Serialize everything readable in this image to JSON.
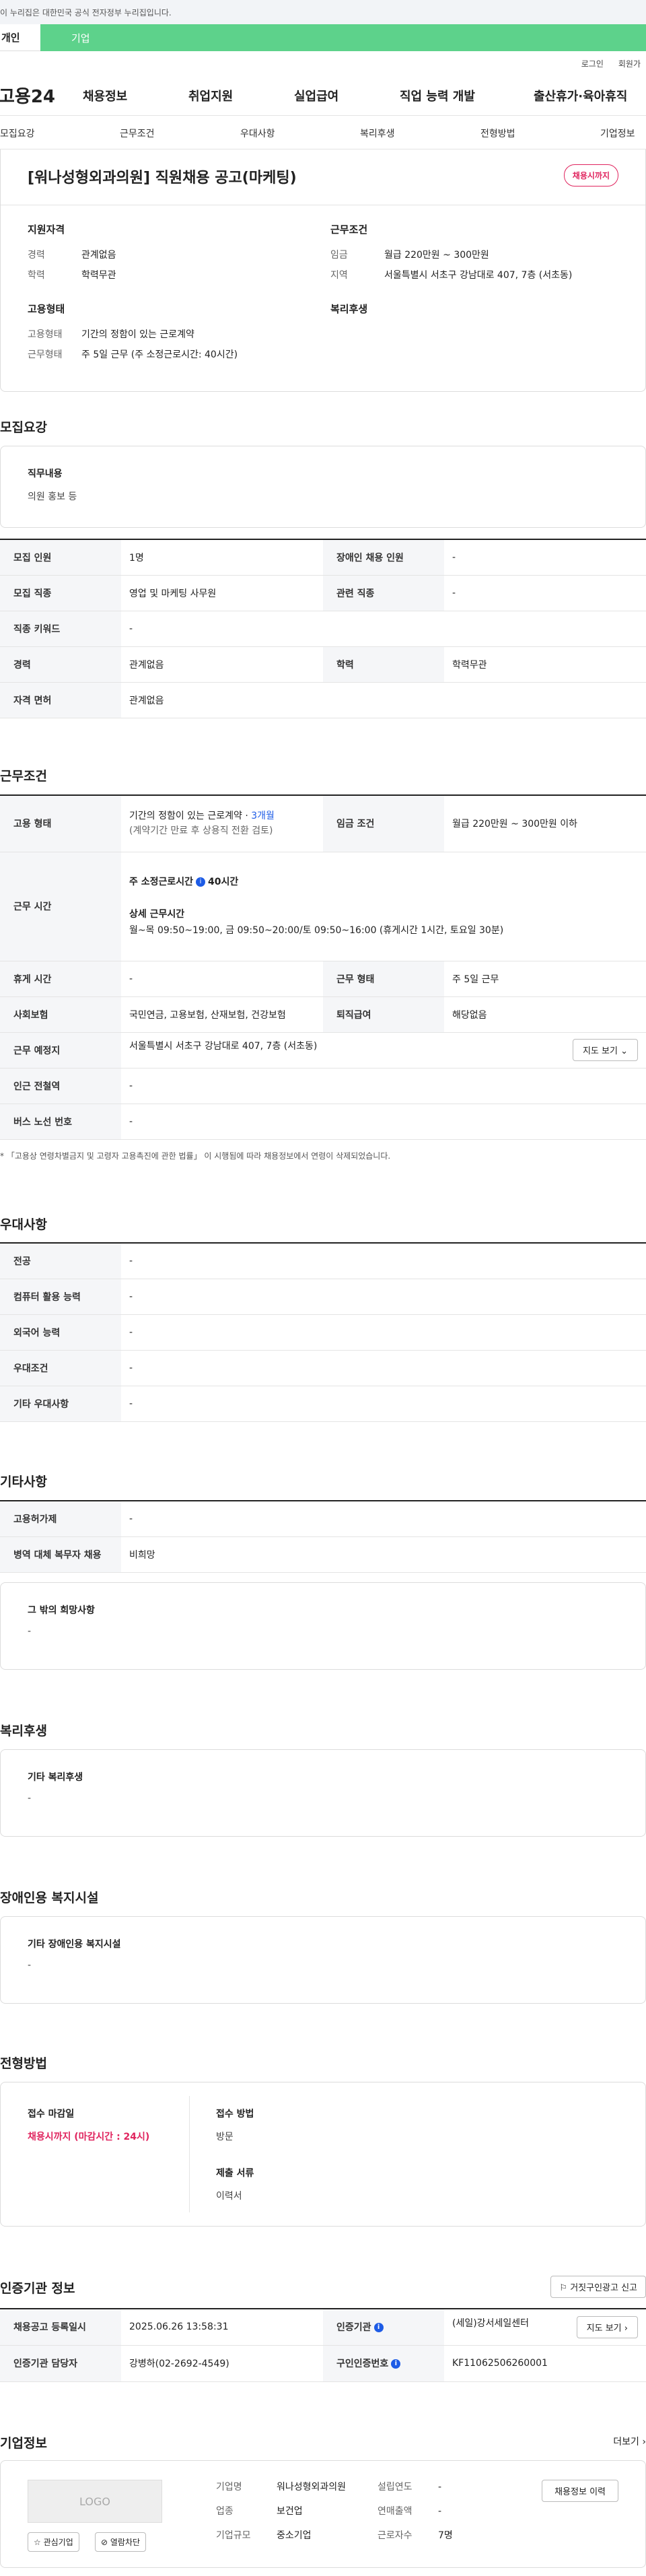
{
  "gov_banner": "이 누리집은 대한민국 공식 전자정부 누리집입니다.",
  "type_tabs": {
    "personal": "개인",
    "company": "기업"
  },
  "util": {
    "login": "로그인",
    "join": "회원가"
  },
  "gnb": {
    "logo": "고용24",
    "menu": [
      "채용정보",
      "취업지원",
      "실업급여",
      "직업 능력 개발",
      "출산휴가·육아휴직"
    ]
  },
  "subnav": [
    "모집요강",
    "근무조건",
    "우대사항",
    "복리후생",
    "전형방법",
    "기업정보"
  ],
  "summary": {
    "title": "[워나성형외과의원] 직원채용 공고(마케팅)",
    "badge": "채용시까지",
    "qual_title": "지원자격",
    "qual": [
      {
        "k": "경력",
        "v": "관계없음"
      },
      {
        "k": "학력",
        "v": "학력무관"
      }
    ],
    "cond_title": "근무조건",
    "cond": [
      {
        "k": "임금",
        "v": "월급 220만원 ~ 300만원"
      },
      {
        "k": "지역",
        "v": "서울특별시 서초구 강남대로 407, 7층 (서초동)"
      }
    ],
    "emp_title": "고용형태",
    "emp": [
      {
        "k": "고용형태",
        "v": "기간의 정함이 있는 근로계약"
      },
      {
        "k": "근무형태",
        "v": "주 5일 근무 (주 소정근로시간: 40시간)"
      }
    ],
    "welfare_title": "복리후생"
  },
  "recruit": {
    "section": "모집요강",
    "job_h": "직무내용",
    "job_b": "의원 홍보 등",
    "rows": {
      "count_k": "모집 인원",
      "count_v": "1명",
      "disabled_k": "장애인 채용 인원",
      "disabled_v": "-",
      "type_k": "모집 직종",
      "type_v": "영업 및 마케팅 사무원",
      "related_k": "관련 직종",
      "related_v": "-",
      "kw_k": "직종 키워드",
      "kw_v": "-",
      "career_k": "경력",
      "career_v": "관계없음",
      "edu_k": "학력",
      "edu_v": "학력무관",
      "license_k": "자격 면허",
      "license_v": "관계없음"
    }
  },
  "work": {
    "section": "근무조건",
    "emp_k": "고용 형태",
    "emp_v1": "기간의 정함이 있는 근로계약 · ",
    "emp_v1b": "3개월",
    "emp_v2": "(계약기간 만료 후 상용직 전환 검토)",
    "wage_k": "임금 조건",
    "wage_v": "월급 220만원 ~ 300만원 이하",
    "time_k": "근무 시간",
    "time_l1": "주 소정근로시간",
    "time_l1v": "40시간",
    "time_l2": "상세 근무시간",
    "time_l3": "월~목 09:50~19:00, 금 09:50~20:00/토 09:50~16:00 (휴게시간 1시간, 토요일 30분)",
    "rest_k": "휴게 시간",
    "rest_v": "-",
    "form_k": "근무 형태",
    "form_v": "주 5일 근무",
    "ins_k": "사회보험",
    "ins_v": "국민연금, 고용보험, 산재보험, 건강보험",
    "ret_k": "퇴직급여",
    "ret_v": "해당없음",
    "place_k": "근무 예정지",
    "place_v": "서울특별시 서초구 강남대로 407, 7층 (서초동)",
    "map_btn": "지도 보기",
    "sub_k": "인근 전철역",
    "sub_v": "-",
    "bus_k": "버스 노선 번호",
    "bus_v": "-",
    "note": "* 「고용상 연령차별금지 및 고령자 고용촉진에 관한 법률」 이 시행됨에 따라 채용정보에서 연령이 삭제되었습니다."
  },
  "pref": {
    "section": "우대사항",
    "rows": [
      {
        "k": "전공",
        "v": "-"
      },
      {
        "k": "컴퓨터 활용 능력",
        "v": "-"
      },
      {
        "k": "외국어 능력",
        "v": "-"
      },
      {
        "k": "우대조건",
        "v": "-"
      },
      {
        "k": "기타 우대사항",
        "v": "-"
      }
    ]
  },
  "etc": {
    "section": "기타사항",
    "rows": [
      {
        "k": "고용허가제",
        "v": "-"
      },
      {
        "k": "병역 대체 복무자 채용",
        "v": "비희망"
      }
    ],
    "box_h": "그 밖의 희망사항",
    "box_b": "-"
  },
  "welfare": {
    "section": "복리후생",
    "box_h": "기타 복리후생",
    "box_b": "-"
  },
  "disabled": {
    "section": "장애인용 복지시설",
    "box_h": "기타 장애인용 복지시설",
    "box_b": "-"
  },
  "process": {
    "section": "전형방법",
    "deadline_h": "접수 마감일",
    "deadline_v": "채용시까지 (마감시간 : 24시)",
    "method_h": "접수 방법",
    "method_v": "방문",
    "docs_h": "제출 서류",
    "docs_v": "이력서"
  },
  "cert": {
    "section": "인증기관 정보",
    "report_btn": "거짓구인광고 신고",
    "reg_k": "채용공고 등록일시",
    "reg_v": "2025.06.26 13:58:31",
    "org_k": "인증기관",
    "org_v": "(세일)강서세일센터",
    "map_btn": "지도 보기",
    "mgr_k": "인증기관 담당자",
    "mgr_v": "강병하(02-2692-4549)",
    "num_k": "구인인증번호",
    "num_v": "KF11062506260001"
  },
  "company": {
    "section": "기업정보",
    "more": "더보기",
    "logo": "LOGO",
    "fav_btn": "관심기업",
    "block_btn": "열람차단",
    "name_k": "기업명",
    "name_v": "워나성형외과의원",
    "est_k": "설립연도",
    "est_v": "-",
    "ind_k": "업종",
    "ind_v": "보건업",
    "sales_k": "연매출액",
    "sales_v": "-",
    "size_k": "기업규모",
    "size_v": "중소기업",
    "emp_k": "근로자수",
    "emp_v": "7명",
    "hist_btn": "채용정보 이력"
  }
}
